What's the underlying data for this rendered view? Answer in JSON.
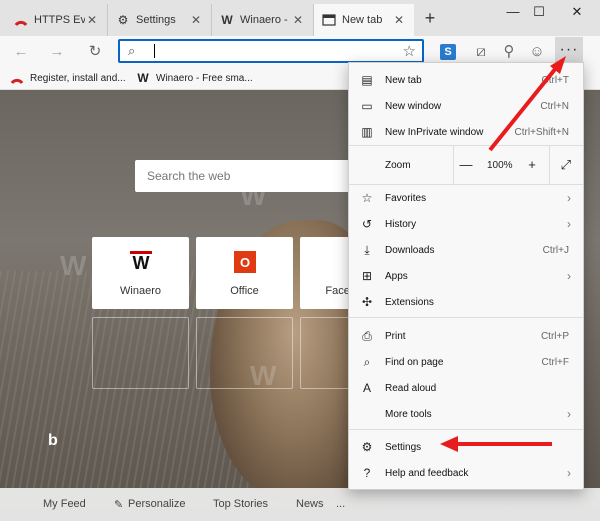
{
  "tabs": [
    {
      "title": "HTTPS Eve",
      "icon": "red-arc-icon"
    },
    {
      "title": "Settings",
      "icon": "gear-icon"
    },
    {
      "title": "Winaero - I",
      "icon": "winaero-w-icon"
    },
    {
      "title": "New tab",
      "icon": "new-tab-icon"
    }
  ],
  "toolbar": {
    "address_value": "",
    "extension_label": "S",
    "more_label": "···"
  },
  "favorites": [
    {
      "label": "Register, install and...",
      "icon": "red-arc-icon"
    },
    {
      "label": "Winaero - Free sma...",
      "icon": "winaero-w-icon"
    }
  ],
  "newtab": {
    "search_placeholder": "Search the web",
    "tiles": [
      {
        "label": "Winaero",
        "icon": "W"
      },
      {
        "label": "Office",
        "icon": "O"
      },
      {
        "label": "Faceb",
        "icon": "f"
      }
    ],
    "bottom_nav": [
      "My Feed",
      "Personalize",
      "Top Stories",
      "News",
      "..."
    ],
    "bing_label": "b"
  },
  "menu": {
    "new_tab": {
      "label": "New tab",
      "shortcut": "Ctrl+T"
    },
    "new_window": {
      "label": "New window",
      "shortcut": "Ctrl+N"
    },
    "new_inprivate": {
      "label": "New InPrivate window",
      "shortcut": "Ctrl+Shift+N"
    },
    "zoom": {
      "label": "Zoom",
      "minus": "—",
      "value": "100%",
      "plus": "+"
    },
    "favorites": {
      "label": "Favorites"
    },
    "history": {
      "label": "History"
    },
    "downloads": {
      "label": "Downloads",
      "shortcut": "Ctrl+J"
    },
    "apps": {
      "label": "Apps"
    },
    "extensions": {
      "label": "Extensions"
    },
    "print": {
      "label": "Print",
      "shortcut": "Ctrl+P"
    },
    "find": {
      "label": "Find on page",
      "shortcut": "Ctrl+F"
    },
    "read_aloud": {
      "label": "Read aloud"
    },
    "more_tools": {
      "label": "More tools"
    },
    "settings": {
      "label": "Settings"
    },
    "help": {
      "label": "Help and feedback"
    }
  },
  "colors": {
    "accent": "#0a64c8",
    "arrow": "#e81c1c"
  }
}
